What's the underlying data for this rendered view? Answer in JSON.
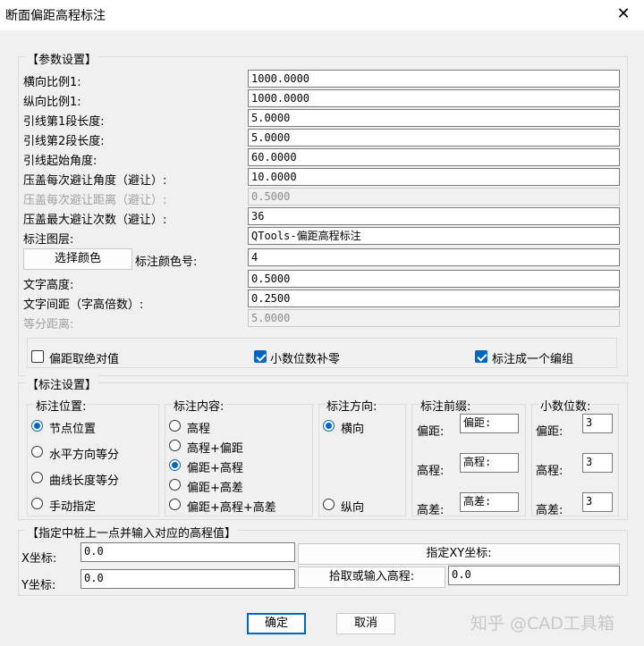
{
  "window": {
    "title": "断面偏距高程标注",
    "close_glyph": "✕"
  },
  "params": {
    "group_title": "【参数设置】",
    "rows": [
      {
        "label": "横向比例1:",
        "value": "1000.0000",
        "disabled": false
      },
      {
        "label": "纵向比例1:",
        "value": "1000.0000",
        "disabled": false
      },
      {
        "label": "引线第1段长度:",
        "value": "5.0000",
        "disabled": false
      },
      {
        "label": "引线第2段长度:",
        "value": "5.0000",
        "disabled": false
      },
      {
        "label": "引线起始角度:",
        "value": "60.0000",
        "disabled": false
      },
      {
        "label": "压盖每次避让角度（避让）:",
        "value": "10.0000",
        "disabled": false
      },
      {
        "label": "压盖每次避让距离（避让）:",
        "value": "0.5000",
        "disabled": true
      },
      {
        "label": "压盖最大避让次数（避让）:",
        "value": "36",
        "disabled": false
      },
      {
        "label": "标注图层:",
        "value": "QTools-偏距高程标注",
        "disabled": false
      }
    ],
    "color_button": "选择颜色",
    "color_label": "标注颜色号:",
    "color_value": "4",
    "text_rows": [
      {
        "label": "文字高度:",
        "value": "0.5000",
        "disabled": false
      },
      {
        "label": "文字间距（字高倍数）:",
        "value": "0.2500",
        "disabled": false
      },
      {
        "label": "等分距离:",
        "value": "5.0000",
        "disabled": true
      }
    ],
    "checks": [
      {
        "label": "偏距取绝对值",
        "checked": false
      },
      {
        "label": "小数位数补零",
        "checked": true
      },
      {
        "label": "标注成一个编组",
        "checked": true
      }
    ]
  },
  "annot": {
    "group_title": "【标注设置】",
    "position": {
      "title": "标注位置:",
      "options": [
        "节点位置",
        "水平方向等分",
        "曲线长度等分",
        "手动指定"
      ],
      "selected": 0
    },
    "content": {
      "title": "标注内容:",
      "options": [
        "高程",
        "高程+偏距",
        "偏距+高程",
        "偏距+高差",
        "偏距+高程+高差"
      ],
      "selected": 2
    },
    "direction": {
      "title": "标注方向:",
      "options": [
        "横向",
        "纵向"
      ],
      "selected": 0
    },
    "prefix": {
      "title": "标注前缀:",
      "rows": [
        {
          "label": "偏距:",
          "value": "偏距:"
        },
        {
          "label": "高程:",
          "value": "高程:"
        },
        {
          "label": "高差:",
          "value": "高差:"
        }
      ]
    },
    "decimals": {
      "title": "小数位数:",
      "rows": [
        {
          "label": "偏距:",
          "value": "3"
        },
        {
          "label": "高程:",
          "value": "3"
        },
        {
          "label": "高差:",
          "value": "3"
        }
      ]
    }
  },
  "pile": {
    "group_title": "【指定中桩上一点并输入对应的高程值】",
    "x_label": "X坐标:",
    "x_value": "0.0",
    "y_label": "Y坐标:",
    "y_value": "0.0",
    "xy_button": "指定XY坐标:",
    "elev_button": "拾取或输入高程:",
    "elev_value": "0.0"
  },
  "footer": {
    "ok": "确定",
    "cancel": "取消"
  },
  "watermark": "知乎 @CAD工具箱"
}
